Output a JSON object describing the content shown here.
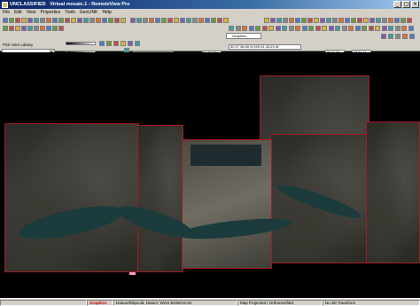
{
  "window": {
    "classification": "UNCLASSIFIED",
    "title": "Virtual mosaic.1 - RemoteView Pro",
    "controls": [
      "_",
      "□",
      "×"
    ]
  },
  "menu": [
    "File",
    "Edit",
    "View",
    "Properties",
    "Tools",
    "GeoLINK",
    "Help"
  ],
  "toolbar": {
    "pick_library": "Pick User Library",
    "graphics_label": "Graphics",
    "zoom_label": "Zoom",
    "zoom_value": "1: 13.00",
    "rotation_label": "Rotation",
    "rotation_value": "0.00",
    "x_label": "X",
    "x_value": "5923.45",
    "y_label": "Y",
    "y_value": "4834.22",
    "coord_text": "30 07 36.90 N 090 01 03.23 W"
  },
  "status": {
    "mode": "Graphics",
    "datum": "Datum/Ellipsoid: Datum: WGS-84/WGS-84",
    "projection": "Map Projected / Orthorectified",
    "transform": "No 3D Transform"
  },
  "colors": {
    "tile_border": "#a21b25",
    "titlebar": "#0a246a",
    "statusbar_text": "#c00000"
  }
}
